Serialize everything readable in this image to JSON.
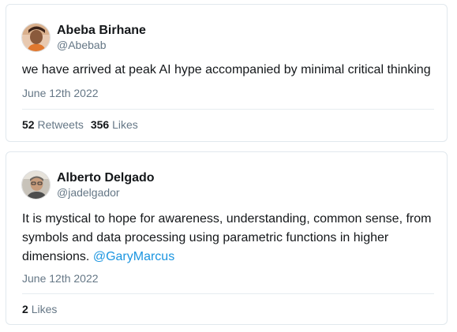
{
  "tweets": [
    {
      "display_name": "Abeba Birhane",
      "handle": "@Abebab",
      "text": "we have arrived at peak AI hype accompanied by minimal critical thinking",
      "date": "June 12th 2022",
      "retweets_count": "52",
      "retweets_label": "Retweets",
      "likes_count": "356",
      "likes_label": "Likes"
    },
    {
      "display_name": "Alberto Delgado",
      "handle": "@jadelgador",
      "text": "It is mystical to hope for awareness, understanding, common sense, from symbols and data processing using parametric functions in higher dimensions.",
      "mention": "@GaryMarcus",
      "date": "June 12th 2022",
      "likes_count": "2",
      "likes_label": "Likes"
    }
  ],
  "colors": {
    "border": "#e1e8ed",
    "name": "#14171a",
    "muted": "#657786",
    "link": "#1b95e0"
  }
}
